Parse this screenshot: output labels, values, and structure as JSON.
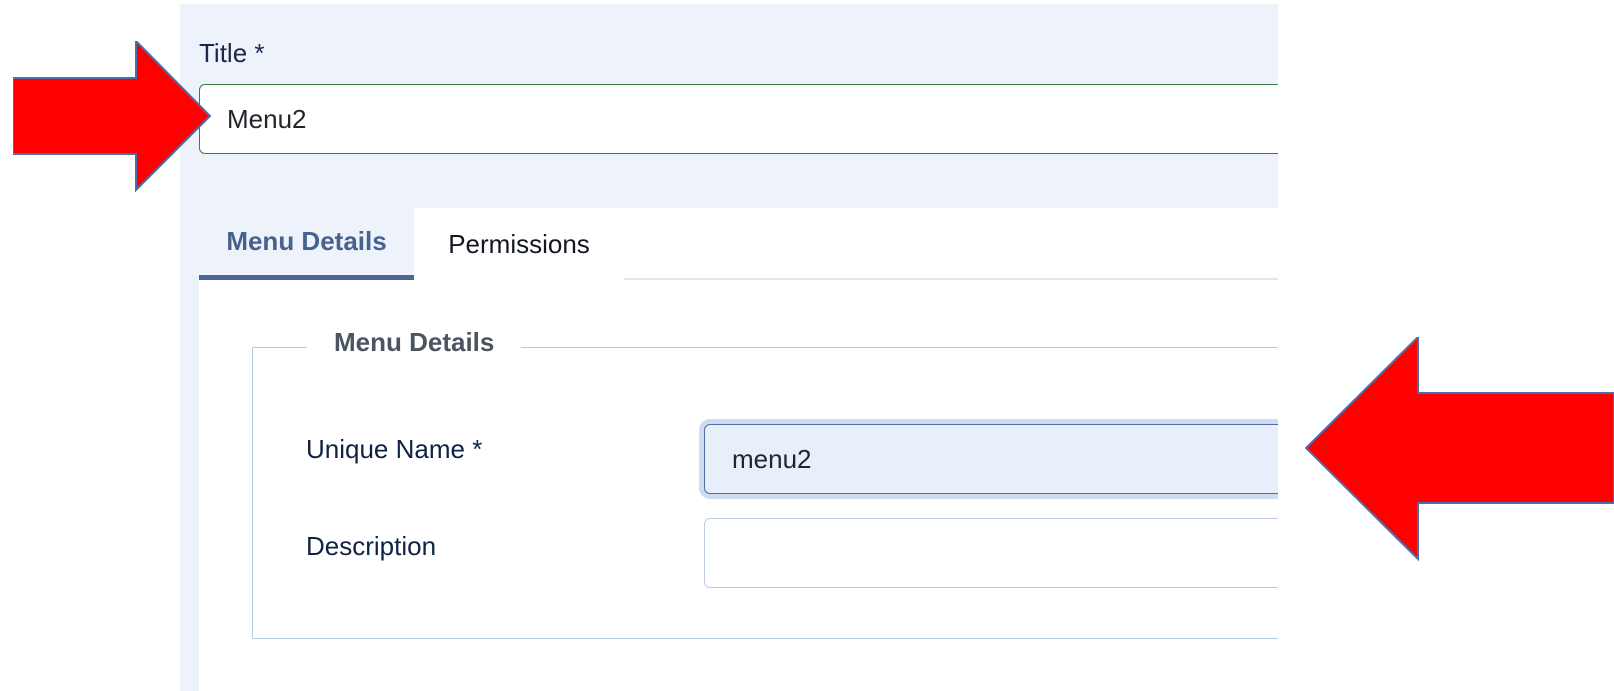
{
  "form": {
    "title_label": "Title *",
    "title_value": "Menu2"
  },
  "tabs": [
    {
      "label": "Menu Details",
      "active": true
    },
    {
      "label": "Permissions",
      "active": false
    }
  ],
  "menu_details": {
    "legend": "Menu Details",
    "unique_name_label": "Unique Name *",
    "unique_name_value": "menu2",
    "description_label": "Description",
    "description_value": ""
  },
  "annotations": {
    "arrow_color": "#ff0000",
    "arrow_outline_color": "#4d6ea8",
    "left_arrow_icon": "red-right-arrow-icon",
    "right_arrow_icon": "red-left-arrow-icon"
  },
  "colors": {
    "admin_background": "#eef2fa",
    "active_tab_text": "#46628f",
    "focused_input_background": "#e9effa",
    "title_input_border": "#3d7a46"
  }
}
